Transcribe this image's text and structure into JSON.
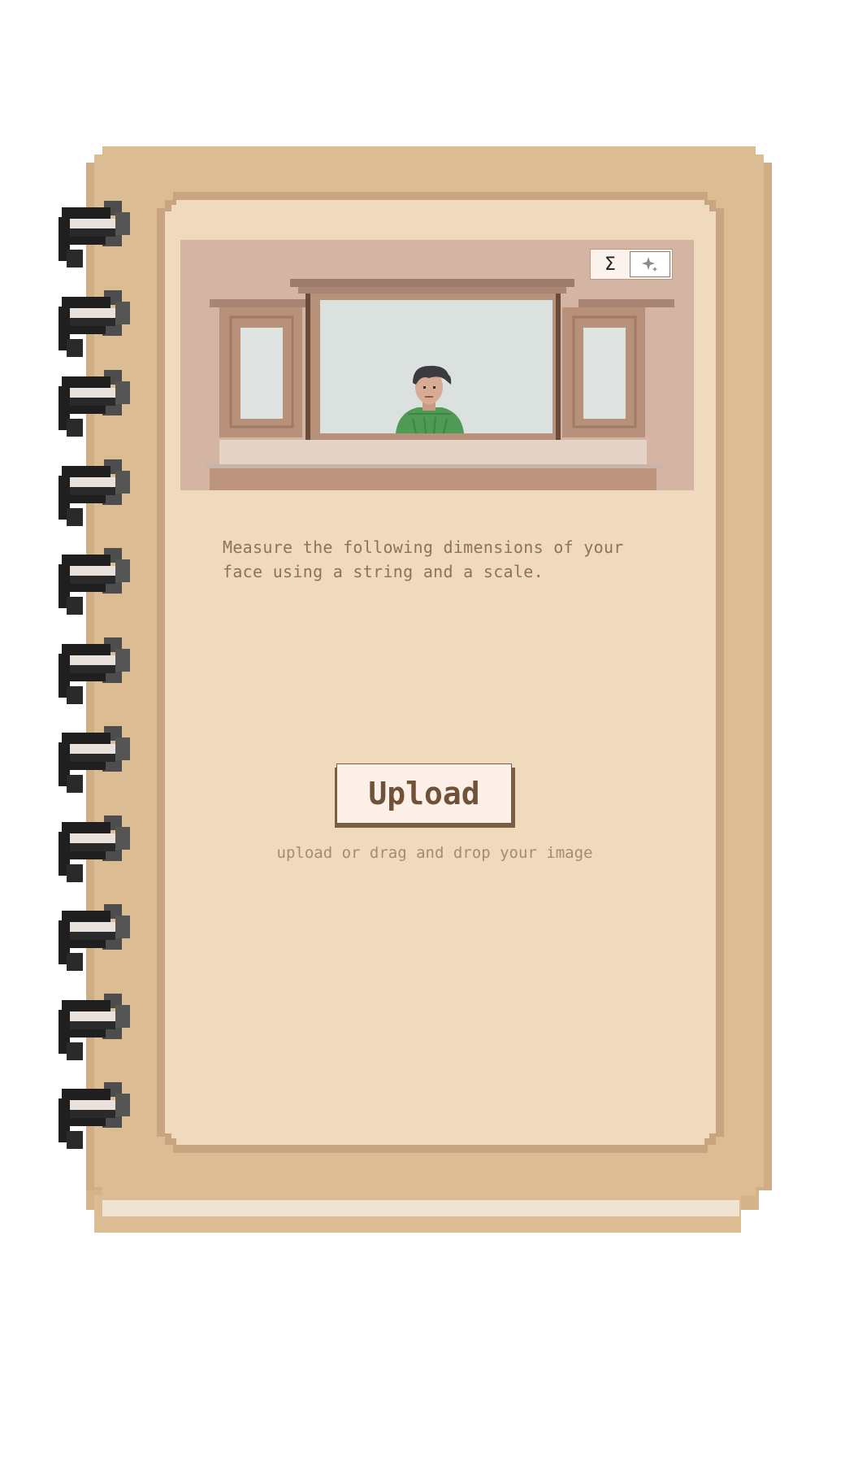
{
  "toggle": {
    "sum_label": "Σ",
    "ai_icon": "sparkle-icon"
  },
  "instructions": {
    "line1": "Measure the following dimensions of your",
    "line2": "face using a string and a scale."
  },
  "upload": {
    "button_label": "Upload",
    "hint": "upload or drag and drop your image"
  },
  "colors": {
    "cover": "#dcbc93",
    "page": "#efdabd",
    "text": "#8f7356",
    "button_text": "#6f5238"
  }
}
